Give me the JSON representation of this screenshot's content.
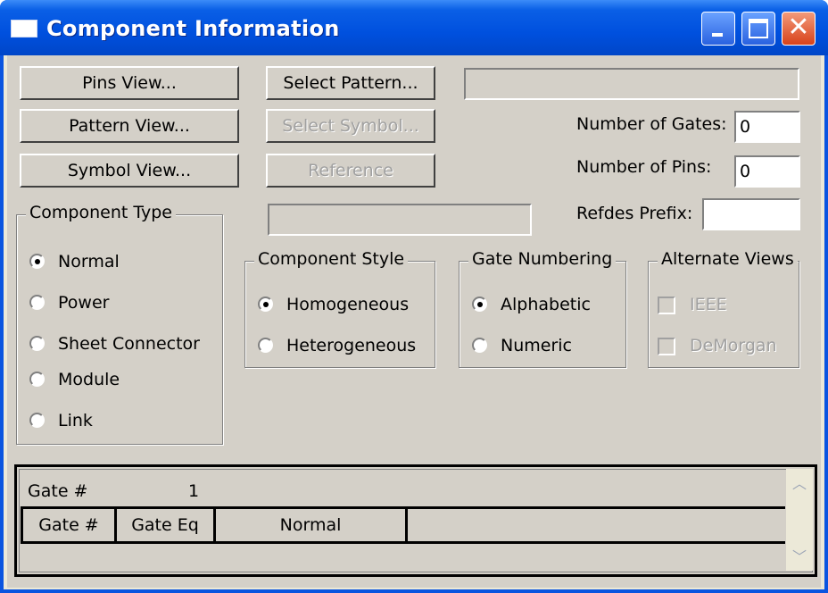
{
  "window": {
    "title": "Component Information"
  },
  "buttons": {
    "pins_view": "Pins View...",
    "pattern_view": "Pattern View...",
    "symbol_view": "Symbol View...",
    "select_pattern": "Select Pattern...",
    "select_symbol": "Select Symbol...",
    "reference": "Reference"
  },
  "fields": {
    "pattern_value": "",
    "number_of_gates_label": "Number of Gates:",
    "number_of_gates_value": "0",
    "number_of_pins_label": "Number of Pins:",
    "number_of_pins_value": "0",
    "refdes_prefix_label": "Refdes Prefix:",
    "refdes_prefix_value": "",
    "symbol_value": ""
  },
  "component_type": {
    "title": "Component Type",
    "options": [
      "Normal",
      "Power",
      "Sheet Connector",
      "Module",
      "Link"
    ],
    "selected": "Normal"
  },
  "component_style": {
    "title": "Component Style",
    "options": [
      "Homogeneous",
      "Heterogeneous"
    ],
    "selected": "Homogeneous"
  },
  "gate_numbering": {
    "title": "Gate Numbering",
    "options": [
      "Alphabetic",
      "Numeric"
    ],
    "selected": "Alphabetic"
  },
  "alternate_views": {
    "title": "Alternate Views",
    "options": [
      "IEEE",
      "DeMorgan"
    ]
  },
  "grid": {
    "gate_label": "Gate #",
    "gate_value": "1",
    "columns": [
      "Gate #",
      "Gate Eq",
      "Normal"
    ]
  },
  "colors": {
    "titlebar": "#0050de",
    "face": "#d4d0c8",
    "close": "#d8421a"
  },
  "icons": {
    "scroll_up": "chevron-up-icon",
    "scroll_down": "chevron-down-icon"
  }
}
